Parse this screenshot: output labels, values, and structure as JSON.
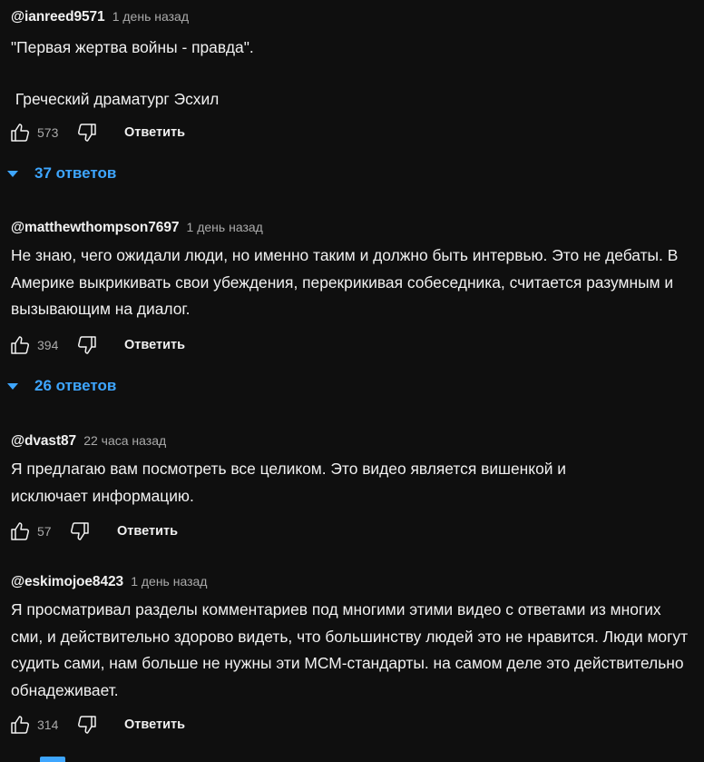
{
  "comments": [
    {
      "author": "@ianreed9571",
      "time": "1 день назад",
      "text": [
        "\"Первая жертва войны - правда\".",
        " Греческий драматург Эсхил"
      ],
      "likes": "573",
      "reply_label": "Ответить",
      "replies": "37 ответов"
    },
    {
      "author": "@matthewthompson7697",
      "time": "1 день назад",
      "text": [
        "Не знаю, чего ожидали люди, но именно таким и должно быть интервью. Это не дебаты. В Америке выкрикивать свои убеждения, перекрикивая собеседника, считается разумным и вызывающим на диалог."
      ],
      "likes": "394",
      "reply_label": "Ответить",
      "replies": "26 ответов"
    },
    {
      "author": "@dvast87",
      "time": "22 часа назад",
      "text": [
        "Я предлагаю вам посмотреть все целиком. Это видео является вишенкой и исключает информацию."
      ],
      "likes": "57",
      "reply_label": "Ответить"
    },
    {
      "author": "@eskimojoe8423",
      "time": "1 день назад",
      "text": [
        "Я просматривал разделы комментариев под многими этими видео с ответами из многих сми, и действительно здорово видеть, что большинству людей это не нравится. Люди могут судить сами, нам больше не нужны эти МСМ-стандарты. на самом деле это действительно обнадеживает."
      ],
      "likes": "314",
      "reply_label": "Ответить"
    }
  ],
  "icons": {
    "like": "thumbs-up-icon",
    "dislike": "thumbs-down-icon",
    "expand": "caret-down-icon"
  },
  "colors": {
    "background": "#0f0f0f",
    "text": "#f1f1f1",
    "secondary": "#aaaaaa",
    "link": "#3ea6ff"
  }
}
